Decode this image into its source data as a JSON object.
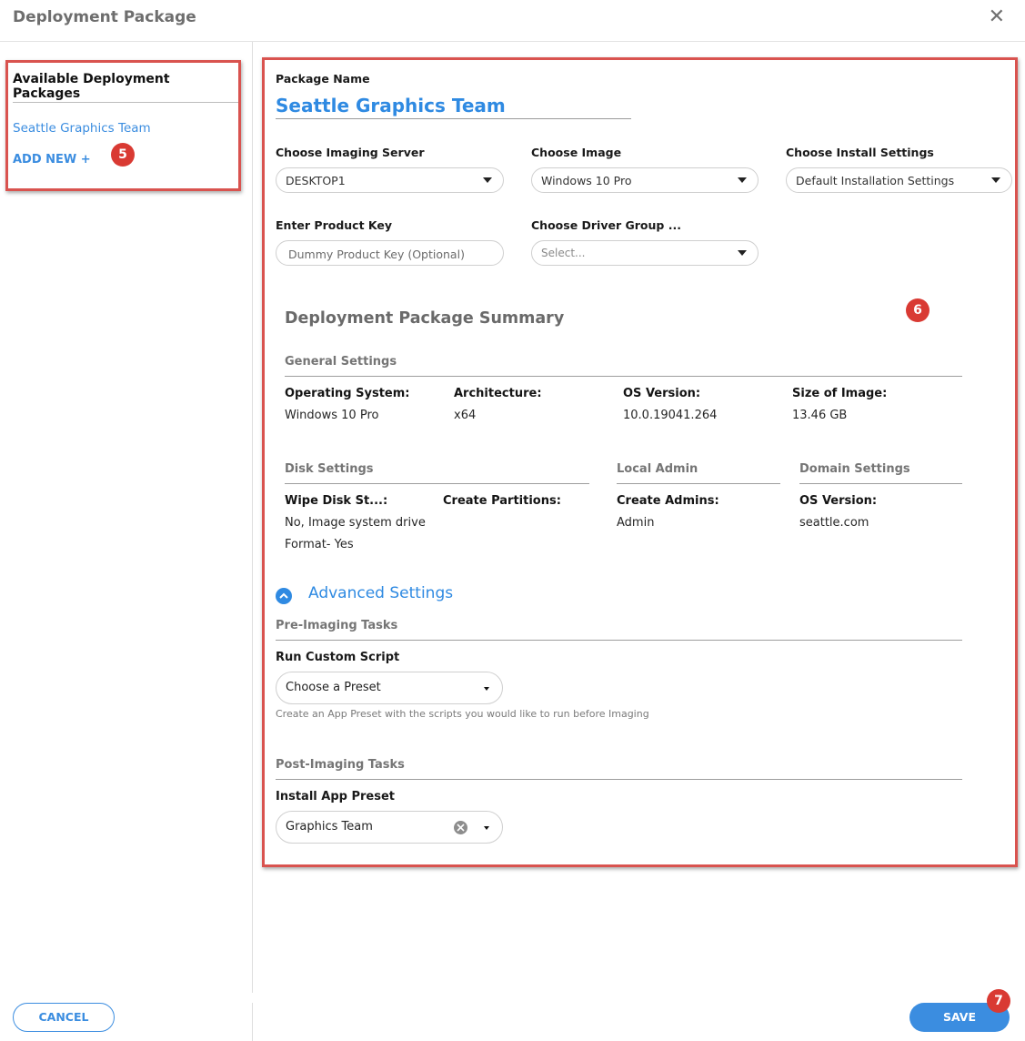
{
  "dialog": {
    "title": "Deployment Package",
    "close_glyph": "✕"
  },
  "sidebar": {
    "title": "Available Deployment Packages",
    "items": [
      "Seattle Graphics Team"
    ],
    "add_new": "ADD NEW +"
  },
  "badges": {
    "sidebar": "5",
    "main": "6",
    "save": "7"
  },
  "form": {
    "package_name_label": "Package Name",
    "package_name_value": "Seattle Graphics Team",
    "imaging_server": {
      "label": "Choose Imaging Server",
      "value": "DESKTOP1"
    },
    "image": {
      "label": "Choose Image",
      "value": "Windows 10 Pro"
    },
    "install_settings": {
      "label": "Choose Install Settings",
      "value": "Default Installation Settings"
    },
    "product_key": {
      "label": "Enter Product Key",
      "placeholder": "Dummy Product Key (Optional)"
    },
    "driver_group": {
      "label": "Choose Driver Group ...",
      "placeholder": "Select..."
    }
  },
  "summary": {
    "title": "Deployment Package Summary",
    "general": {
      "title": "General Settings",
      "fields": [
        {
          "key": "Operating System:",
          "value": "Windows 10 Pro"
        },
        {
          "key": "Architecture:",
          "value": "x64"
        },
        {
          "key": "OS Version:",
          "value": "10.0.19041.264"
        },
        {
          "key": "Size of Image:",
          "value": "13.46 GB"
        }
      ]
    },
    "disk": {
      "title": "Disk Settings",
      "wipe_key": "Wipe Disk St...:",
      "wipe_value_1": "No, Image system drive",
      "wipe_value_2": "Format- Yes",
      "partitions_key": "Create Partitions:"
    },
    "local_admin": {
      "title": "Local Admin",
      "key": "Create Admins:",
      "value": "Admin"
    },
    "domain": {
      "title": "Domain Settings",
      "key": "OS Version:",
      "value": "seattle.com"
    }
  },
  "advanced": {
    "label": "Advanced Settings",
    "pre_title": "Pre-Imaging Tasks",
    "run_script_label": "Run Custom Script",
    "run_script_value": "Choose a Preset",
    "run_script_help": "Create an App Preset with the scripts you would like to run before Imaging",
    "post_title": "Post-Imaging Tasks",
    "install_preset_label": "Install App Preset",
    "install_preset_value": "Graphics Team"
  },
  "footer": {
    "cancel": "CANCEL",
    "save": "SAVE"
  },
  "colors": {
    "accent": "#3b8de0",
    "highlight_border": "#d9534f",
    "badge": "#d93a33"
  }
}
